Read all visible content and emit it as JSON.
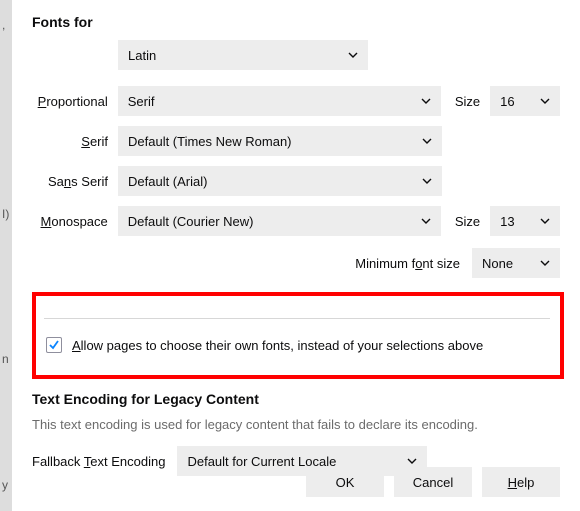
{
  "stray": {
    "s1": ",",
    "s2": "I)",
    "s3": "n",
    "s4": "y"
  },
  "sections": {
    "fonts_for": "Fonts for",
    "encoding_title": "Text Encoding for Legacy Content",
    "encoding_desc": "This text encoding is used for legacy content that fails to declare its encoding."
  },
  "fontfor": {
    "value": "Latin"
  },
  "labels": {
    "proportional_pre": "P",
    "proportional_rest": "roportional",
    "serif_pre": "S",
    "serif_rest": "erif",
    "sans_pre": "S",
    "sans_rest": "ans Serif",
    "sans_prefix": "Sa",
    "mono_pre": "M",
    "mono_rest": "onospace",
    "size": "Size",
    "min_pre": "Minimum f",
    "min_u": "o",
    "min_post": "nt size",
    "fallback_pre": "Fallback ",
    "fallback_u": "T",
    "fallback_post": "ext Encoding",
    "allow_pre": "A",
    "allow_rest": "llow pages to choose their own fonts, instead of your selections above"
  },
  "values": {
    "proportional": "Serif",
    "serif": "Default (Times New Roman)",
    "sans": "Default (Arial)",
    "mono": "Default (Courier New)",
    "size_prop": "16",
    "size_mono": "13",
    "min": "None",
    "fallback": "Default for Current Locale"
  },
  "buttons": {
    "ok": "OK",
    "cancel": "Cancel",
    "help_u": "H",
    "help_rest": "elp"
  }
}
